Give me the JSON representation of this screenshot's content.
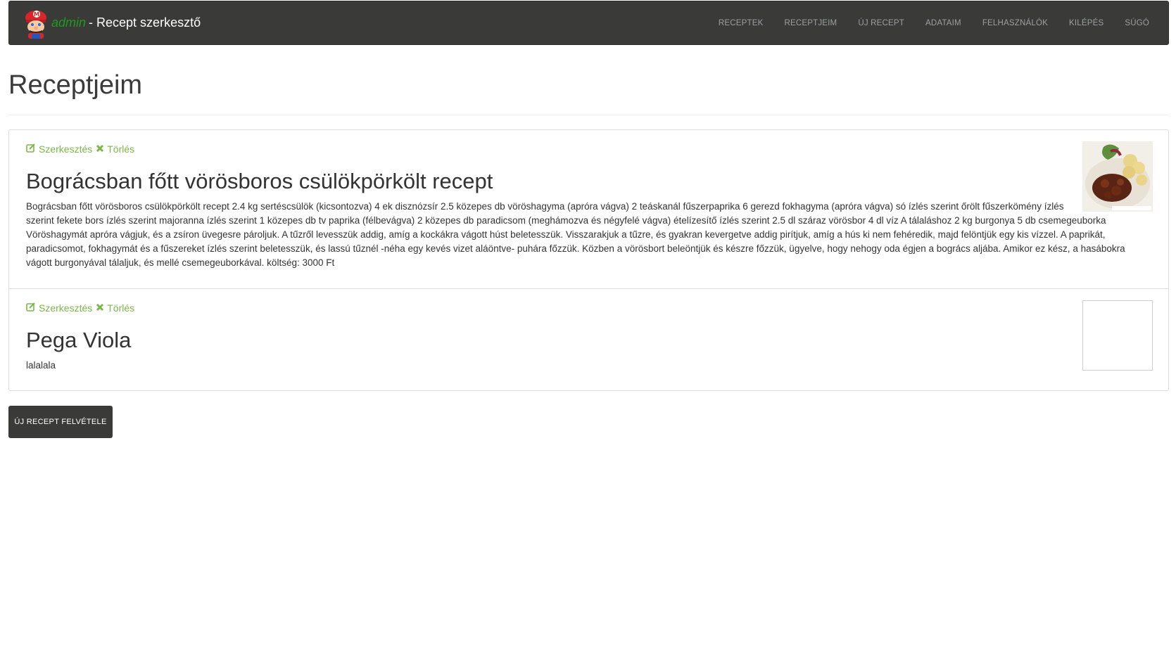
{
  "header": {
    "user": "admin",
    "title": "- Recept szerkesztő",
    "nav": [
      "RECEPTEK",
      "RECEPTJEIM",
      "ÚJ RECEPT",
      "ADATAIM",
      "FELHASZNÁLÓK",
      "KILÉPÉS",
      "SÚGÓ"
    ]
  },
  "page_title": "Receptjeim",
  "actions": {
    "edit": "Szerkesztés",
    "delete": "Törlés"
  },
  "recipes": [
    {
      "title": "Bográcsban főtt vörösboros csülökpörkölt recept",
      "text": "Bográcsban főtt vörösboros csülökpörkölt recept 2.4 kg sertéscsülök (kicsontozva) 4 ek disznózsír 2.5 közepes db vöröshagyma (apróra vágva) 2 teáskanál fűszerpaprika 6 gerezd fokhagyma (apróra vágva) só ízlés szerint őrölt fűszerkömény ízlés szerint fekete bors ízlés szerint majoranna ízlés szerint 1 közepes db tv paprika (félbevágva) 2 közepes db paradicsom (meghámozva és négyfelé vágva) ételízesítő ízlés szerint 2.5 dl száraz vörösbor 4 dl víz A tálaláshoz 2 kg burgonya 5 db csemegeuborka Vöröshagymát apróra vágjuk, és a zsíron üvegesre pároljuk. A tűzről levesszük addig, amíg a kockákra vágott húst beletesszük. Visszarakjuk a tűzre, és gyakran kevergetve addig pirítjuk, amíg a hús ki nem fehéredik, majd felöntjük egy kis vízzel. A paprikát, paradicsomot, fokhagymát és a fűszereket ízlés szerint beletesszük, és lassú tűznél -néha egy kevés vizet aláöntve- puhára főzzük. Közben a vörösbort beleöntjük és készre főzzük, ügyelve, hogy nehogy oda égjen a bogrács aljába. Amikor ez kész, a hasábokra vágott burgonyával tálaljuk, és mellé csemegeuborkával. költség: 3000 Ft"
    },
    {
      "title": "Pega Viola",
      "text": "lalalala"
    }
  ],
  "new_recipe_button": "ÚJ RECEPT FELVÉTELE",
  "colors": {
    "navbar_bg": "#3a3b38",
    "action_green": "#7ab84a",
    "user_green": "#1f9a1f"
  }
}
